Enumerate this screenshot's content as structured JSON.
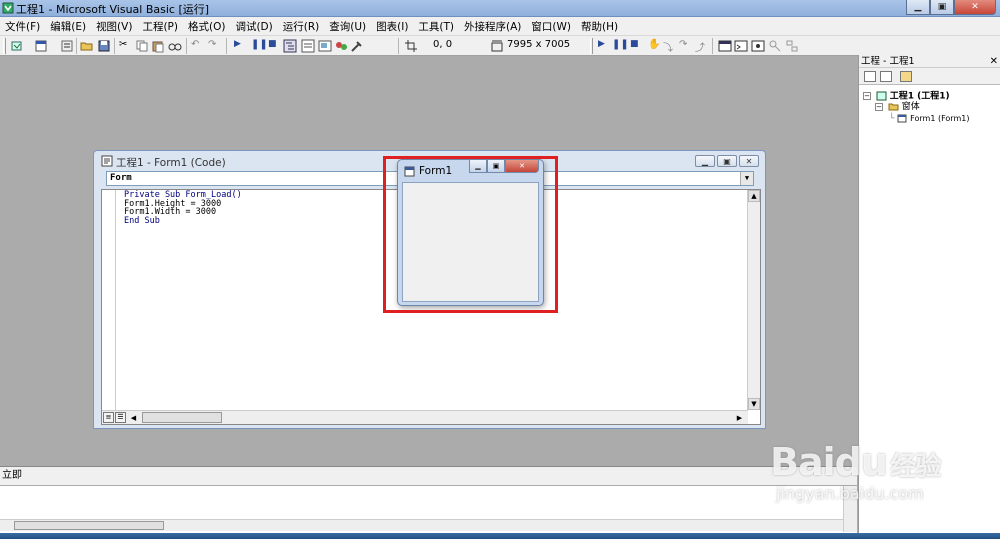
{
  "window": {
    "title": "工程1 - Microsoft Visual Basic [运行]",
    "minimize": "▁",
    "maximize": "▣",
    "close": "✕"
  },
  "menu": [
    "文件(F)",
    "编辑(E)",
    "视图(V)",
    "工程(P)",
    "格式(O)",
    "调试(D)",
    "运行(R)",
    "查询(U)",
    "图表(I)",
    "工具(T)",
    "外接程序(A)",
    "窗口(W)",
    "帮助(H)"
  ],
  "toolbar": {
    "position_readout": "0, 0",
    "size_readout": "7995 x 7005"
  },
  "code_window": {
    "title": "工程1 - Form1 (Code)",
    "object_combo": "Form",
    "code_lines": [
      "Private Sub Form_Load()",
      "Form1.Height = 3000",
      "Form1.Width = 3000",
      "End Sub"
    ]
  },
  "form1": {
    "title": "Form1"
  },
  "project_explorer": {
    "title": "工程 - 工程1",
    "close": "✕",
    "tree": {
      "project": "工程1 (工程1)",
      "folder": "窗体",
      "form": "Form1 (Form1)"
    }
  },
  "immediate": {
    "title": "立即"
  },
  "watermark": {
    "brand": "Baidu",
    "brand_cn": "经验",
    "url": "jingyan.baidu.com"
  },
  "colors": {
    "highlight": "#e02020",
    "mdi_background": "#ababab",
    "keyword": "#000080"
  }
}
